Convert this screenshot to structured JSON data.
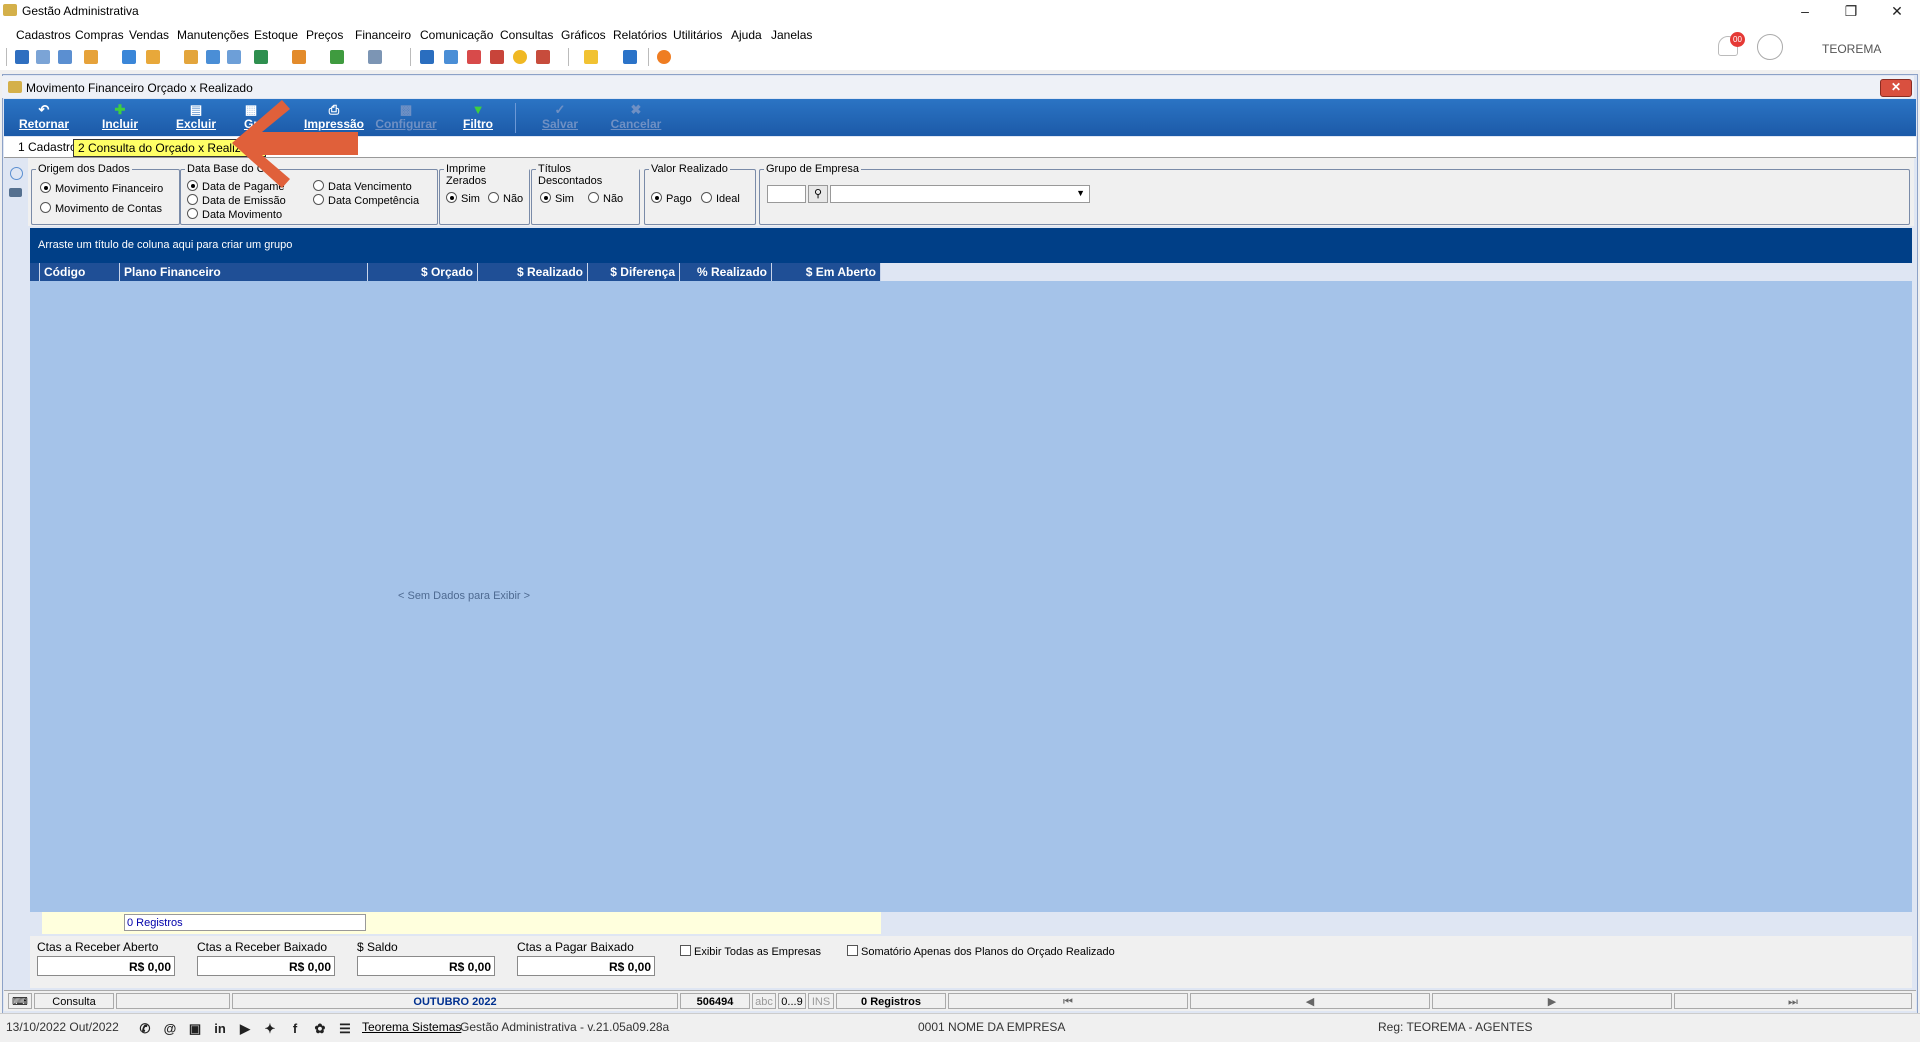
{
  "window": {
    "title": "Gestão Administrativa",
    "user_label": "TEOREMA",
    "notif_count": "00"
  },
  "menu": [
    "Cadastros",
    "Compras",
    "Vendas",
    "Manutenções",
    "Estoque",
    "Preços",
    "Financeiro",
    "Comunicação",
    "Consultas",
    "Gráficos",
    "Relatórios",
    "Utilitários",
    "Ajuda",
    "Janelas"
  ],
  "child": {
    "title": "Movimento Financeiro Orçado x Realizado",
    "close_label": "✕"
  },
  "ribbon": {
    "retornar": "Retornar",
    "incluir": "Incluir",
    "excluir": "Excluir",
    "grid": "Gr",
    "impressao": "Impressão",
    "configurar": "Configurar",
    "filtro": "Filtro",
    "salvar": "Salvar",
    "cancelar": "Cancelar"
  },
  "tabs": {
    "tab1": "1 Cadastro",
    "tab2": "2 Consulta do Orçado x Realizado"
  },
  "filters": {
    "origem": {
      "label": "Origem dos Dados",
      "opt1": "Movimento Financeiro",
      "opt2": "Movimento de Contas"
    },
    "database": {
      "label": "Data Base do Ca",
      "opt1": "Data de Pagame",
      "opt2": "Data de Emissão",
      "opt3": "Data Movimento",
      "opt4": "Data Vencimento",
      "opt5": "Data Competência"
    },
    "imprime": {
      "label": "Imprime Zerados",
      "sim": "Sim",
      "nao": "Não"
    },
    "titulos": {
      "label": "Títulos Descontados",
      "sim": "Sim",
      "nao": "Não"
    },
    "valor": {
      "label": "Valor Realizado",
      "pago": "Pago",
      "ideal": "Ideal"
    },
    "grupo": {
      "label": "Grupo de Empresa"
    }
  },
  "grid": {
    "groupbar_hint": "Arraste um título de coluna aqui para criar um grupo",
    "columns": [
      "Código",
      "Plano Financeiro",
      "$ Orçado",
      "$ Realizado",
      "$ Diferença",
      "% Realizado",
      "$ Em Aberto"
    ],
    "empty_text": "< Sem Dados para Exibir >",
    "footer_count": "0 Registros"
  },
  "totals": {
    "receber_aberto": {
      "label": "Ctas a Receber Aberto",
      "value": "R$ 0,00"
    },
    "receber_baixado": {
      "label": "Ctas a Receber Baixado",
      "value": "R$ 0,00"
    },
    "saldo": {
      "label": "$ Saldo",
      "value": "R$ 0,00"
    },
    "pagar_baixado": {
      "label": "Ctas a Pagar Baixado",
      "value": "R$ 0,00"
    },
    "chk_todas": "Exibir Todas as Empresas",
    "chk_somatorio": "Somatório Apenas dos Planos do Orçado Realizado"
  },
  "status1": {
    "mode": "Consulta",
    "period": "OUTUBRO 2022",
    "code": "506494",
    "abc": "abc",
    "range": "0...9",
    "ins": "INS",
    "records": "0 Registros"
  },
  "status2": {
    "date": "13/10/2022 Out/2022",
    "company_link": "Teorema Sistemas",
    "version": "Gestão Administrativa - v.21.05a09.28a",
    "empresa": "0001 NOME DA EMPRESA",
    "reg": "Reg: TEOREMA - AGENTES"
  },
  "colors": {
    "ribbon": "#1c5aa8",
    "grid_body": "#a5c3e9",
    "group_bar": "#003f87",
    "tab_highlight": "#ffff66",
    "arrow": "#e0603a"
  }
}
